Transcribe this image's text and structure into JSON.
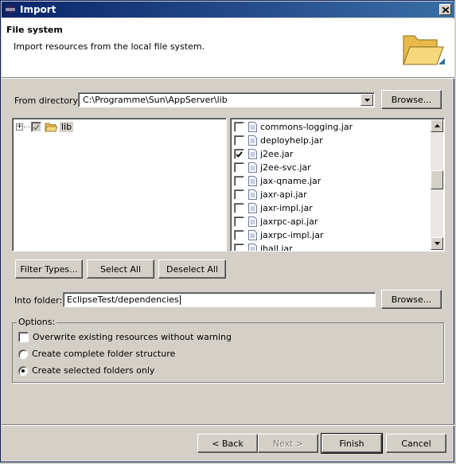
{
  "window": {
    "title": "Import"
  },
  "header": {
    "title": "File system",
    "description": "Import resources from the local file system."
  },
  "from_directory": {
    "label": "From directory:",
    "value": "C:\\Programme\\Sun\\AppServer\\lib",
    "browse_label": "Browse..."
  },
  "tree": {
    "items": [
      {
        "label": "lib",
        "checked": "partial"
      }
    ]
  },
  "files": [
    {
      "name": "commons-logging.jar",
      "checked": false
    },
    {
      "name": "deployhelp.jar",
      "checked": false
    },
    {
      "name": "j2ee.jar",
      "checked": true
    },
    {
      "name": "j2ee-svc.jar",
      "checked": false
    },
    {
      "name": "jax-qname.jar",
      "checked": false
    },
    {
      "name": "jaxr-api.jar",
      "checked": false
    },
    {
      "name": "jaxr-impl.jar",
      "checked": false
    },
    {
      "name": "jaxrpc-api.jar",
      "checked": false
    },
    {
      "name": "jaxrpc-impl.jar",
      "checked": false
    },
    {
      "name": "jhall.jar",
      "checked": false
    }
  ],
  "selection_buttons": {
    "filter_types": "Filter Types...",
    "select_all": "Select All",
    "deselect_all": "Deselect All"
  },
  "into_folder": {
    "label": "Into folder:",
    "value": "EclipseTest/dependencies",
    "browse_label": "Browse..."
  },
  "options": {
    "legend": "Options:",
    "overwrite": {
      "label": "Overwrite existing resources without warning",
      "checked": false
    },
    "complete_structure": {
      "label": "Create complete folder structure",
      "selected": false
    },
    "selected_only": {
      "label": "Create selected folders only",
      "selected": true
    }
  },
  "footer": {
    "back": "< Back",
    "next": "Next >",
    "finish": "Finish",
    "cancel": "Cancel"
  }
}
